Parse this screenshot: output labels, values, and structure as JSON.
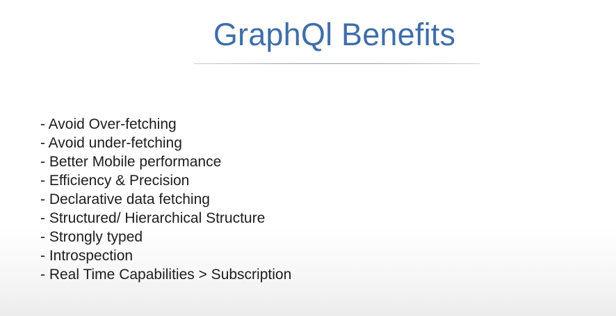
{
  "slide": {
    "title": "GraphQl Benefits",
    "bullets": [
      "- Avoid Over-fetching",
      "- Avoid under-fetching",
      "- Better Mobile performance",
      "- Efficiency & Precision",
      "- Declarative data fetching",
      "- Structured/ Hierarchical Structure",
      "- Strongly typed",
      "- Introspection",
      "- Real Time Capabilities > Subscription"
    ]
  },
  "colors": {
    "title": "#3f6ea8",
    "text": "#1c1c1c",
    "background": "#ffffff"
  }
}
